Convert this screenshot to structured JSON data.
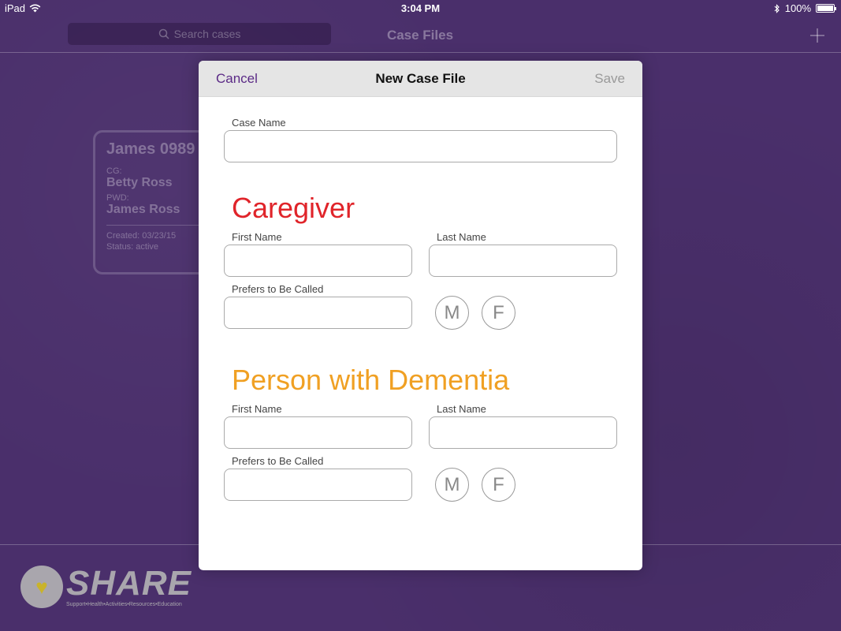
{
  "status_bar": {
    "device": "iPad",
    "time": "3:04 PM",
    "battery": "100%"
  },
  "navbar": {
    "search_placeholder": "Search cases",
    "title": "Case Files",
    "add_icon": "plus-icon"
  },
  "case_card": {
    "title": "James 0989",
    "cg_label": "CG:",
    "cg_name": "Betty Ross",
    "pwd_label": "PWD:",
    "pwd_name": "James Ross",
    "created": "Created: 03/23/15",
    "status": "Status: active"
  },
  "modal": {
    "cancel_label": "Cancel",
    "title": "New Case File",
    "save_label": "Save",
    "case_name_label": "Case Name",
    "case_name_value": "",
    "caregiver": {
      "heading": "Caregiver",
      "first_name_label": "First Name",
      "last_name_label": "Last Name",
      "prefers_label": "Prefers to Be Called",
      "male_label": "M",
      "female_label": "F"
    },
    "pwd": {
      "heading": "Person with Dementia",
      "first_name_label": "First Name",
      "last_name_label": "Last Name",
      "prefers_label": "Prefers to Be Called",
      "male_label": "M",
      "female_label": "F"
    }
  },
  "footer": {
    "logo_word": "SHARE",
    "logo_tagline": "Support•Health•Activities•Resources•Education"
  },
  "colors": {
    "background": "#4a2f6b",
    "caregiver": "#e0242a",
    "pwd": "#f0a023",
    "accent": "#5b2a86"
  }
}
